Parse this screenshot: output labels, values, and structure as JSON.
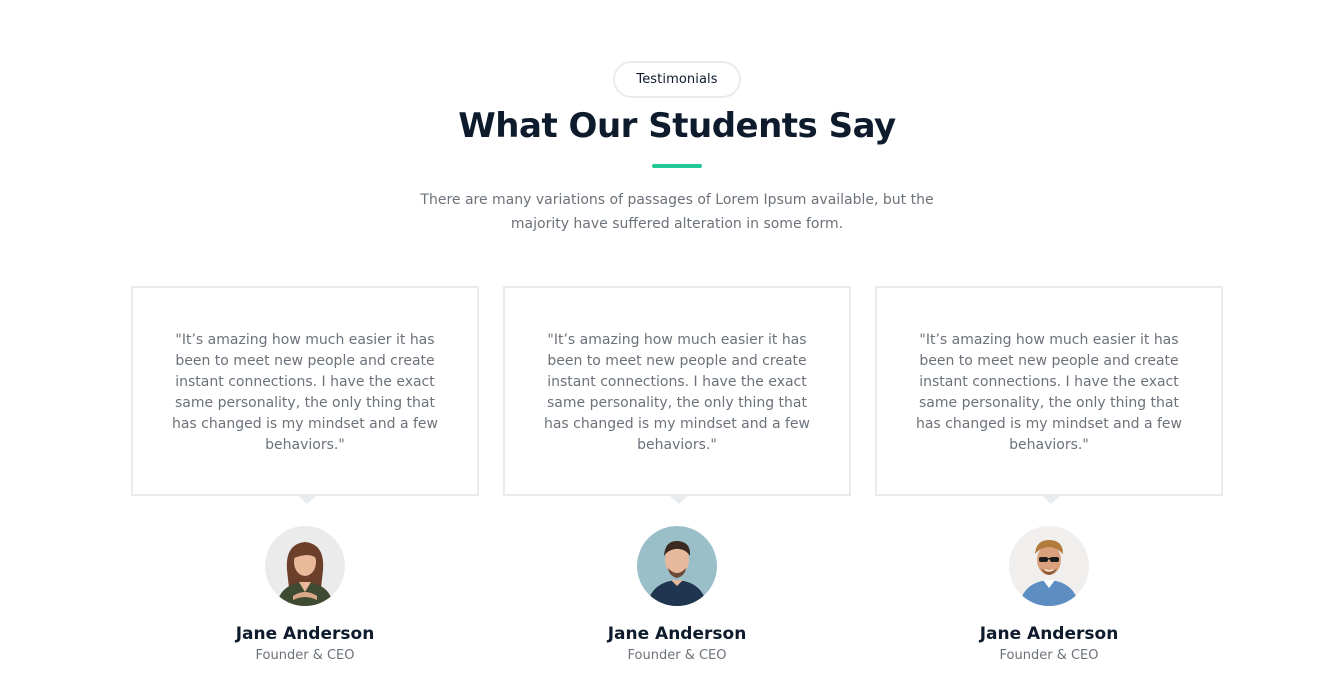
{
  "header": {
    "badge": "Testimonials",
    "title": "What Our Students Say",
    "subtitle": "There are many variations of passages of Lorem Ipsum available, but the majority have suffered alteration in some form."
  },
  "colors": {
    "accent": "#20c997",
    "heading": "#0e1b2c",
    "body_text": "#6c727a",
    "border": "#e9ecef"
  },
  "testimonials": [
    {
      "quote": "\"It’s amazing how much easier it has been to meet new people and create instant connections. I have the exact same personality, the only thing that has changed is my mindset and a few behaviors.\"",
      "name": "Jane Anderson",
      "role": "Founder & CEO",
      "avatar_icon": "woman-avatar"
    },
    {
      "quote": "\"It’s amazing how much easier it has been to meet new people and create instant connections. I have the exact same personality, the only thing that has changed is my mindset and a few behaviors.\"",
      "name": "Jane Anderson",
      "role": "Founder & CEO",
      "avatar_icon": "man-avatar"
    },
    {
      "quote": "\"It’s amazing how much easier it has been to meet new people and create instant connections. I have the exact same personality, the only thing that has changed is my mindset and a few behaviors.\"",
      "name": "Jane Anderson",
      "role": "Founder & CEO",
      "avatar_icon": "man-sunglasses-avatar"
    }
  ]
}
